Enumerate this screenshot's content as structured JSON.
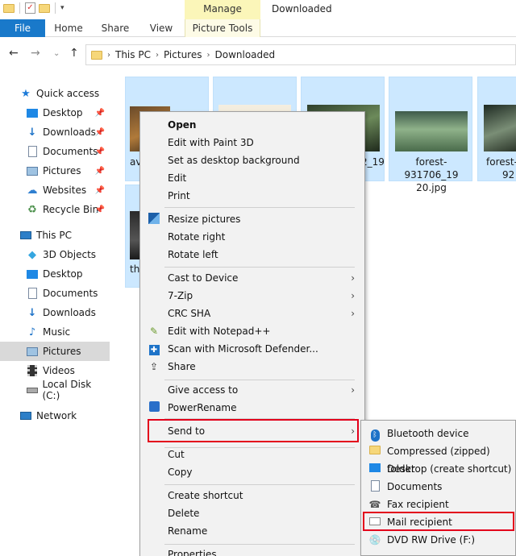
{
  "window": {
    "title": "Downloaded",
    "contextual_tab_group": "Manage"
  },
  "ribbon": {
    "tabs": [
      "File",
      "Home",
      "Share",
      "View",
      "Picture Tools"
    ]
  },
  "address": {
    "crumbs": [
      "This PC",
      "Pictures",
      "Downloaded"
    ]
  },
  "nav": {
    "quick_access": "Quick access",
    "quick_items": [
      "Desktop",
      "Downloads",
      "Documents",
      "Pictures",
      "Websites",
      "Recycle Bin"
    ],
    "this_pc": "This PC",
    "pc_items": [
      "3D Objects",
      "Desktop",
      "Documents",
      "Downloads",
      "Music",
      "Pictures",
      "Videos",
      "Local Disk (C:)"
    ],
    "network": "Network",
    "selected": "Pictures"
  },
  "files": {
    "tile1_label": "av",
    "tile4_label_line1": "2_19",
    "tile5_label_line1": "forest-931706_19",
    "tile5_label_line2": "20.jpg",
    "tile6_label_line1": "forest-",
    "tile6_label_line2": "92",
    "tile7_label": "th"
  },
  "context_menu": {
    "open": "Open",
    "edit_paint3d": "Edit with Paint 3D",
    "set_bg": "Set as desktop background",
    "edit": "Edit",
    "print": "Print",
    "resize": "Resize pictures",
    "rotate_right": "Rotate right",
    "rotate_left": "Rotate left",
    "cast": "Cast to Device",
    "sevenzip": "7-Zip",
    "crc": "CRC SHA",
    "notepad": "Edit with Notepad++",
    "defender": "Scan with Microsoft Defender...",
    "share": "Share",
    "give_access": "Give access to",
    "powerrename": "PowerRename",
    "send_to": "Send to",
    "cut": "Cut",
    "copy": "Copy",
    "create_shortcut": "Create shortcut",
    "delete": "Delete",
    "rename": "Rename",
    "properties": "Properties"
  },
  "send_to_menu": {
    "items": [
      "Bluetooth device",
      "Compressed (zipped) folder",
      "Desktop (create shortcut)",
      "Documents",
      "Fax recipient",
      "Mail recipient",
      "DVD RW Drive (F:)"
    ]
  },
  "colors": {
    "selection": "#cce8ff",
    "file_tab": "#1979ca",
    "manage_tab": "#fbf6b9",
    "highlight": "#e3001b",
    "menu_bg": "#f2f2f2"
  }
}
